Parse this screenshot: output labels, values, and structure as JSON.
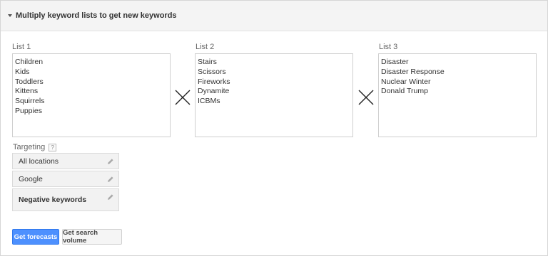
{
  "header": {
    "title": "Multiply keyword lists to get new keywords"
  },
  "lists": [
    {
      "label": "List 1",
      "items": [
        "Children",
        "Kids",
        "Toddlers",
        "Kittens",
        "Squirrels",
        "Puppies"
      ]
    },
    {
      "label": "List 2",
      "items": [
        "Stairs",
        "Scissors",
        "Fireworks",
        "Dynamite",
        "ICBMs"
      ]
    },
    {
      "label": "List 3",
      "items": [
        "Disaster",
        "Disaster Response",
        "Nuclear Winter",
        "Donald Trump"
      ]
    }
  ],
  "targeting": {
    "label": "Targeting",
    "help": "?",
    "location": "All locations",
    "network": "Google",
    "negative": "Negative keywords"
  },
  "actions": {
    "forecasts": "Get forecasts",
    "search_volume": "Get search volume"
  },
  "colors": {
    "primary": "#4d90fe",
    "header_bg": "#f4f4f4"
  }
}
